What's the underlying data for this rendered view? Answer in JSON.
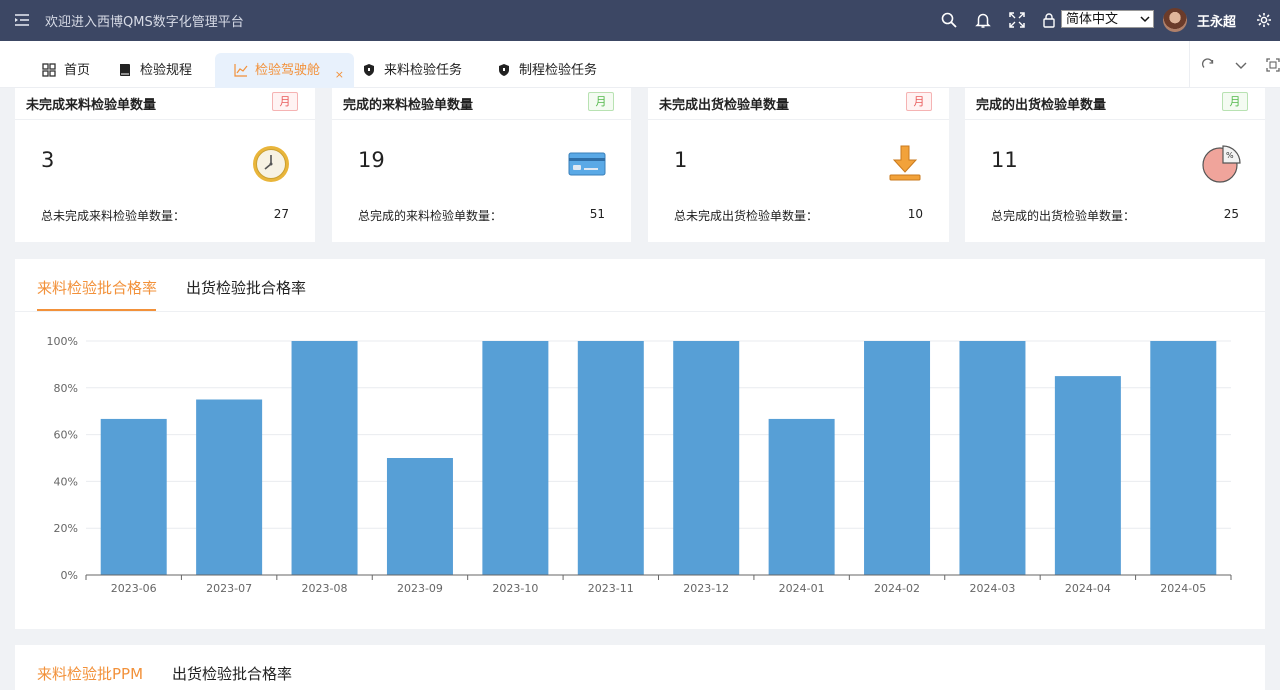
{
  "topbar": {
    "title": "欢迎进入西博QMS数字化管理平台",
    "language": "简体中文",
    "user_name": "王永超"
  },
  "tabs": [
    {
      "label": "首页",
      "icon": "grid-icon"
    },
    {
      "label": "检验规程",
      "icon": "book-icon"
    },
    {
      "label": "检验驾驶舱",
      "icon": "line-chart-icon",
      "active": true
    },
    {
      "label": "来料检验任务",
      "icon": "shield-icon"
    },
    {
      "label": "制程检验任务",
      "icon": "shield-icon"
    }
  ],
  "tab_close": "×",
  "cards": [
    {
      "title": "未完成来料检验单数量",
      "badge": "月",
      "value": "3",
      "sub": "总未完成来料检验单数量：",
      "total": "27",
      "icon": "clock-icon"
    },
    {
      "title": "完成的来料检验单数量",
      "badge": "月",
      "value": "19",
      "sub": "总完成的来料检验单数量：",
      "total": "51",
      "icon": "card-icon"
    },
    {
      "title": "未完成出货检验单数量",
      "badge": "月",
      "value": "1",
      "sub": "总未完成出货检验单数量：",
      "total": "10",
      "icon": "download-icon"
    },
    {
      "title": "完成的出货检验单数量",
      "badge": "月",
      "value": "11",
      "sub": "总完成的出货检验单数量：",
      "total": "25",
      "icon": "pie-percent-icon"
    }
  ],
  "panel": {
    "tab_active": "来料检验批合格率",
    "tab_other": "出货检验批合格率"
  },
  "panel2": {
    "tab_active": "来料检验批PPM",
    "tab_other": "出货检验批合格率"
  },
  "colors": {
    "topbar": "#3c4764",
    "accent": "#f2913a",
    "bar": "#579fd6"
  },
  "chart_data": {
    "type": "bar",
    "categories": [
      "2023-06",
      "2023-07",
      "2023-08",
      "2023-09",
      "2023-10",
      "2023-11",
      "2023-12",
      "2024-01",
      "2024-02",
      "2024-03",
      "2024-04",
      "2024-05"
    ],
    "values": [
      66.7,
      75,
      100,
      50,
      100,
      100,
      100,
      66.7,
      100,
      100,
      85,
      100
    ],
    "yticks": [
      "0%",
      "20%",
      "40%",
      "60%",
      "80%",
      "100%"
    ],
    "ylim": [
      0,
      100
    ],
    "grid": true
  }
}
